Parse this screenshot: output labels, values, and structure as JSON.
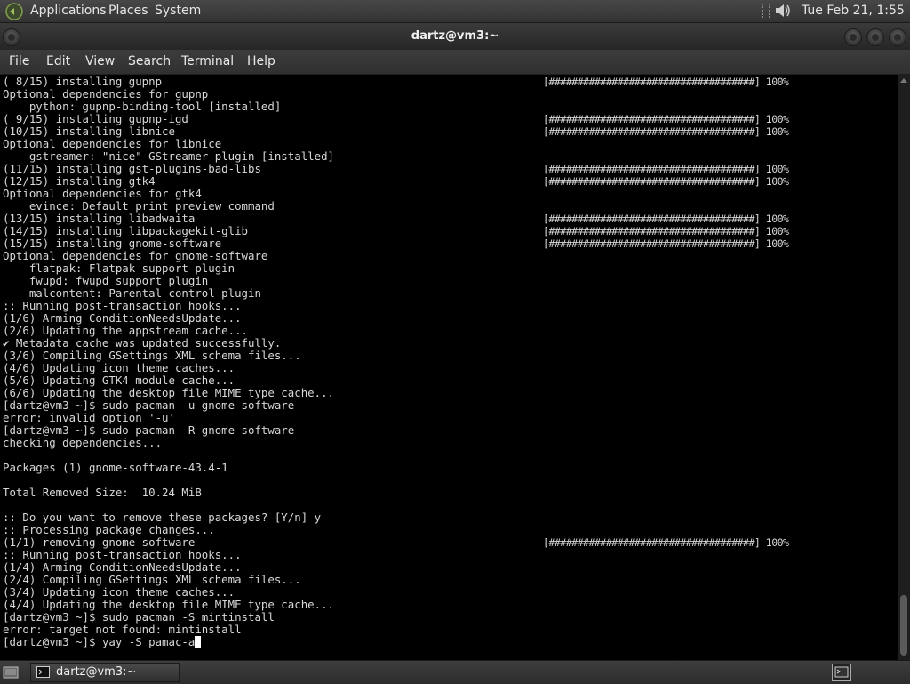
{
  "top_panel": {
    "menus": [
      "Applications",
      "Places",
      "System"
    ],
    "clock": "Tue Feb 21,  1:55 PM",
    "icons": [
      "distro-logo-icon",
      "volume-icon"
    ]
  },
  "window": {
    "title": "dartz@vm3:~",
    "menu": [
      "File",
      "Edit",
      "View",
      "Search",
      "Terminal",
      "Help"
    ]
  },
  "terminal": {
    "lines": [
      {
        "text": "( 8/15) installing gupnp",
        "bar": "[####################################] 100%"
      },
      {
        "text": "Optional dependencies for gupnp"
      },
      {
        "text": "    python: gupnp-binding-tool [installed]"
      },
      {
        "text": "( 9/15) installing gupnp-igd",
        "bar": "[####################################] 100%"
      },
      {
        "text": "(10/15) installing libnice",
        "bar": "[####################################] 100%"
      },
      {
        "text": "Optional dependencies for libnice"
      },
      {
        "text": "    gstreamer: \"nice\" GStreamer plugin [installed]"
      },
      {
        "text": "(11/15) installing gst-plugins-bad-libs",
        "bar": "[####################################] 100%"
      },
      {
        "text": "(12/15) installing gtk4",
        "bar": "[####################################] 100%"
      },
      {
        "text": "Optional dependencies for gtk4"
      },
      {
        "text": "    evince: Default print preview command"
      },
      {
        "text": "(13/15) installing libadwaita",
        "bar": "[####################################] 100%"
      },
      {
        "text": "(14/15) installing libpackagekit-glib",
        "bar": "[####################################] 100%"
      },
      {
        "text": "(15/15) installing gnome-software",
        "bar": "[####################################] 100%"
      },
      {
        "text": "Optional dependencies for gnome-software"
      },
      {
        "text": "    flatpak: Flatpak support plugin"
      },
      {
        "text": "    fwupd: fwupd support plugin"
      },
      {
        "text": "    malcontent: Parental control plugin"
      },
      {
        "text": ":: Running post-transaction hooks..."
      },
      {
        "text": "(1/6) Arming ConditionNeedsUpdate..."
      },
      {
        "text": "(2/6) Updating the appstream cache..."
      },
      {
        "text": "✔ Metadata cache was updated successfully."
      },
      {
        "text": "(3/6) Compiling GSettings XML schema files..."
      },
      {
        "text": "(4/6) Updating icon theme caches..."
      },
      {
        "text": "(5/6) Updating GTK4 module cache..."
      },
      {
        "text": "(6/6) Updating the desktop file MIME type cache..."
      },
      {
        "text": "[dartz@vm3 ~]$ sudo pacman -u gnome-software"
      },
      {
        "text": "error: invalid option '-u'"
      },
      {
        "text": "[dartz@vm3 ~]$ sudo pacman -R gnome-software"
      },
      {
        "text": "checking dependencies..."
      },
      {
        "text": ""
      },
      {
        "text": "Packages (1) gnome-software-43.4-1"
      },
      {
        "text": ""
      },
      {
        "text": "Total Removed Size:  10.24 MiB"
      },
      {
        "text": ""
      },
      {
        "text": ":: Do you want to remove these packages? [Y/n] y"
      },
      {
        "text": ":: Processing package changes..."
      },
      {
        "text": "(1/1) removing gnome-software",
        "bar": "[####################################] 100%"
      },
      {
        "text": ":: Running post-transaction hooks..."
      },
      {
        "text": "(1/4) Arming ConditionNeedsUpdate..."
      },
      {
        "text": "(2/4) Compiling GSettings XML schema files..."
      },
      {
        "text": "(3/4) Updating icon theme caches..."
      },
      {
        "text": "(4/4) Updating the desktop file MIME type cache..."
      },
      {
        "text": "[dartz@vm3 ~]$ sudo pacman -S mintinstall"
      },
      {
        "text": "error: target not found: mintinstall"
      },
      {
        "text": "[dartz@vm3 ~]$ yay -S pamac-a",
        "cursor": true
      }
    ]
  },
  "taskbar": {
    "task_label": "dartz@vm3:~",
    "icons": [
      "show-desktop-icon",
      "terminal-icon",
      "workspace-switcher-icon"
    ]
  },
  "colors": {
    "panel": "#3a3a3a",
    "terminal_bg": "#000000",
    "terminal_fg": "#d8d8d8"
  }
}
